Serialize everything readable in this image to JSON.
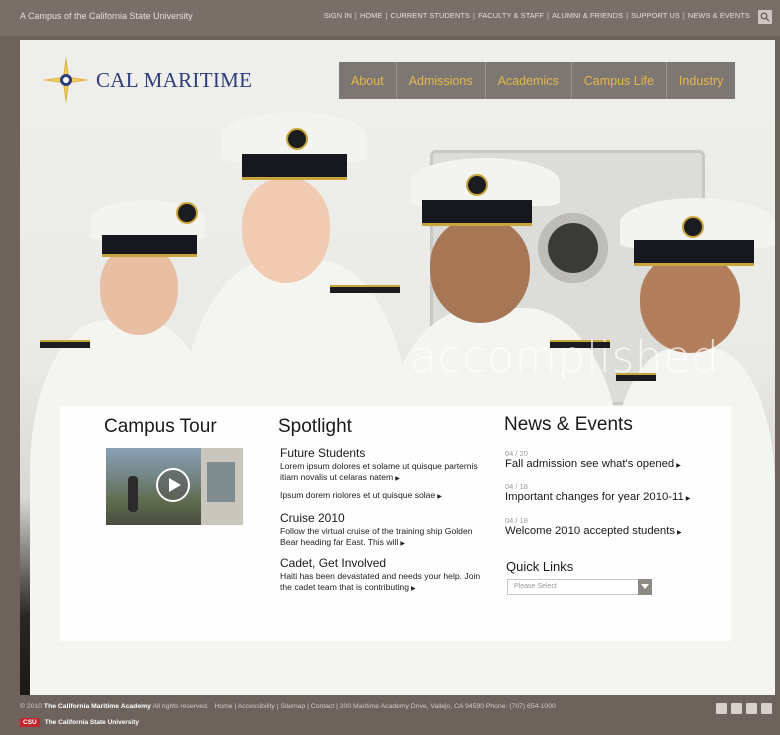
{
  "topbar": {
    "campus_text": "A Campus of the California State University",
    "links": [
      "SIGN IN",
      "HOME",
      "CURRENT STUDENTS",
      "FACULTY & STAFF",
      "ALUMNI & FRIENDS",
      "SUPPORT US",
      "NEWS & EVENTS"
    ],
    "separator": "|",
    "search_icon": "search-icon"
  },
  "logo": {
    "text": "CAL MARITIME",
    "icon": "compass-rose-icon"
  },
  "nav": {
    "items": [
      "About",
      "Admissions",
      "Academics",
      "Campus Life",
      "Industry"
    ]
  },
  "hero": {
    "tagline": "accomplished"
  },
  "campus_tour": {
    "title": "Campus Tour",
    "play_icon": "play-icon"
  },
  "spotlight": {
    "title": "Spotlight",
    "items": [
      {
        "title": "Future Students",
        "body": "Lorem ipsum dolores et solame ut quisque parternis itiam novalis ut celaras natem"
      },
      {
        "title": "",
        "body": "Ipsum dorem riolores et ut quisque solae"
      },
      {
        "title": "Cruise 2010",
        "body": "Follow the virtual cruise of the training ship Golden Bear heading far East. This will"
      },
      {
        "title": "Cadet, Get Involved",
        "body": "Haiti has been devastated and needs your help. Join the cadet team that is contributing"
      }
    ]
  },
  "news": {
    "title": "News & Events",
    "items": [
      {
        "date": "04 / 20",
        "title": "Fall admission see what's opened"
      },
      {
        "date": "04 / 18",
        "title": "Important changes for year 2010-11"
      },
      {
        "date": "04 / 18",
        "title": "Welcome 2010 accepted students"
      }
    ]
  },
  "quick_links": {
    "title": "Quick Links",
    "placeholder": "Please Select"
  },
  "footer": {
    "copyright": "© 2010",
    "org": "The California Maritime Academy",
    "rights": "All rights reserved.",
    "links": [
      "Home",
      "Accessibility",
      "Sitemap",
      "Contact",
      "200 Maritime Academy Drive, Vallejo, CA 94590 Phone: (707) 654-1000"
    ],
    "csu_mark": "CSU",
    "csu_name": "The California State University",
    "social_icons": [
      "twitter-icon",
      "facebook-icon",
      "flickr-icon",
      "rss-icon"
    ]
  },
  "colors": {
    "nav_text": "#e6b84a",
    "logo_text": "#2e3c7e",
    "csu_red": "#c0272d",
    "frame": "#6e625d"
  }
}
